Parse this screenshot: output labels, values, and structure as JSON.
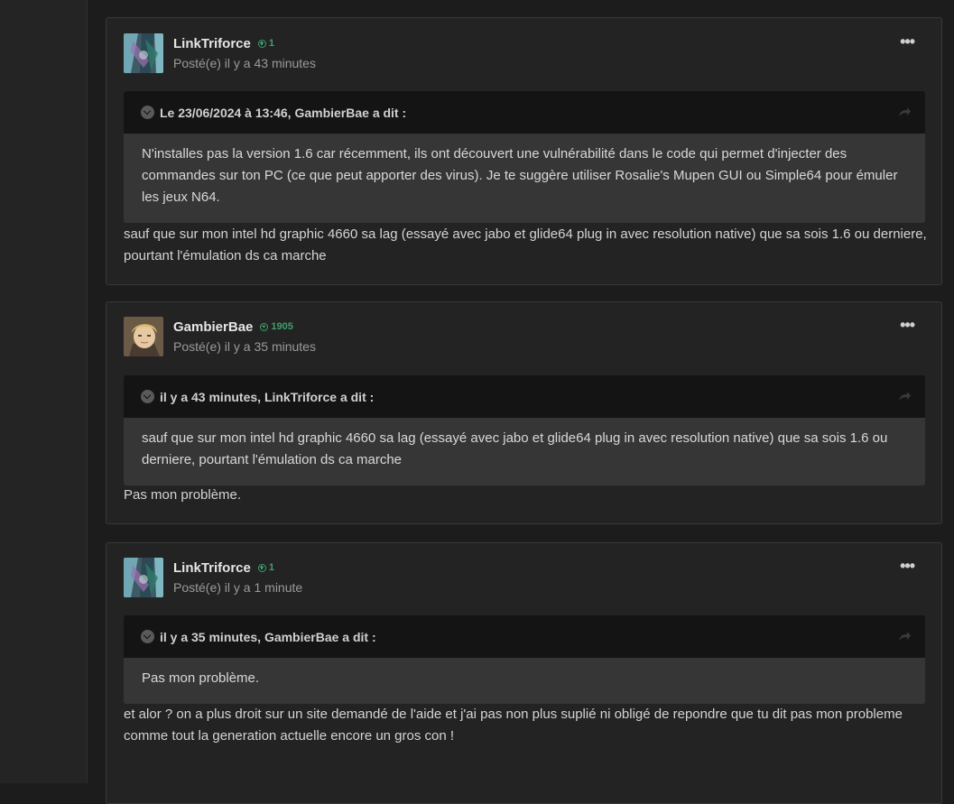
{
  "posts": [
    {
      "author": "LinkTriforce",
      "rep": "1",
      "posted": "Posté(e) il y a 43 minutes",
      "more": "•••",
      "quote": {
        "cite": "Le 23/06/2024 à 13:46, GambierBae a dit :",
        "body": "N'installes pas la version 1.6 car récemment, ils ont découvert une vulnérabilité dans le code qui permet d'injecter des commandes sur ton PC (ce que peut apporter des virus). Je te suggère utiliser Rosalie's Mupen GUI ou Simple64 pour émuler les jeux N64."
      },
      "text": "sauf que sur mon intel hd graphic 4660 sa lag (essayé avec jabo et glide64 plug in avec resolution native) que sa sois 1.6 ou derniere, pourtant l'émulation ds ca marche"
    },
    {
      "author": "GambierBae",
      "rep": "1905",
      "posted": "Posté(e) il y a 35 minutes",
      "more": "•••",
      "quote": {
        "cite": "il y a 43 minutes, LinkTriforce a dit :",
        "body": "sauf que sur mon intel hd graphic 4660 sa lag (essayé avec jabo et glide64 plug in avec resolution native) que sa sois 1.6 ou derniere, pourtant l'émulation ds ca marche"
      },
      "text": "Pas mon problème."
    },
    {
      "author": "LinkTriforce",
      "rep": "1",
      "posted": "Posté(e) il y a 1 minute",
      "more": "•••",
      "quote": {
        "cite": "il y a 35 minutes, GambierBae a dit :",
        "body": "Pas mon problème."
      },
      "text_line1": "et alor ?  on a plus droit sur un site demandé de l'aide et j'ai pas non plus suplié ni obligé de repondre que tu dit pas mon probleme",
      "text_line2": "comme tout la generation actuelle encore un  gros con !"
    }
  ],
  "colors": {
    "background": "#1c1c1c",
    "post_bg": "#232323",
    "quote_head": "#141414",
    "quote_body": "#363636",
    "reputation": "#3fa06a"
  },
  "icons": {
    "reputation": "plus-circle-icon",
    "quote_toggle": "chevron-down-icon",
    "quote_share": "share-arrow-icon",
    "more": "ellipsis-icon"
  }
}
